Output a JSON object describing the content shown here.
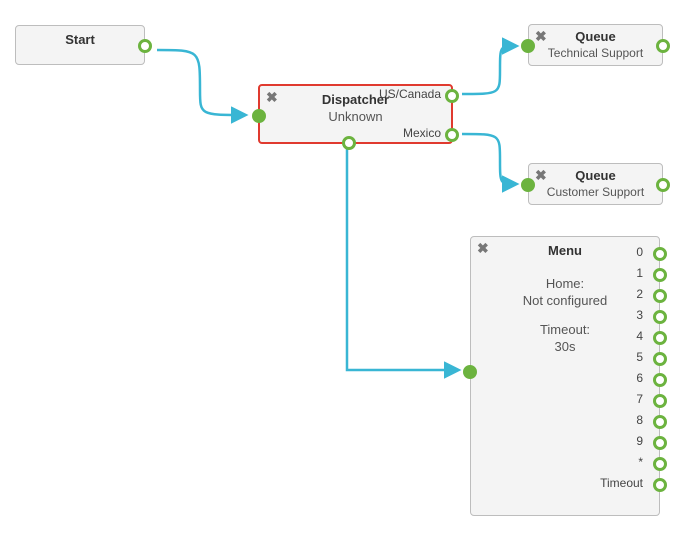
{
  "start": {
    "title": "Start"
  },
  "dispatcher": {
    "title": "Dispatcher",
    "subtitle": "Unknown",
    "out1": "US/Canada",
    "out2": "Mexico"
  },
  "queue1": {
    "title": "Queue",
    "subtitle": "Technical Support"
  },
  "queue2": {
    "title": "Queue",
    "subtitle": "Customer Support"
  },
  "menu": {
    "title": "Menu",
    "home_label": "Home:",
    "home_value": "Not configured",
    "timeout_label": "Timeout:",
    "timeout_value": "30s",
    "opts": [
      "0",
      "1",
      "2",
      "3",
      "4",
      "5",
      "6",
      "7",
      "8",
      "9",
      "*",
      "Timeout"
    ]
  }
}
